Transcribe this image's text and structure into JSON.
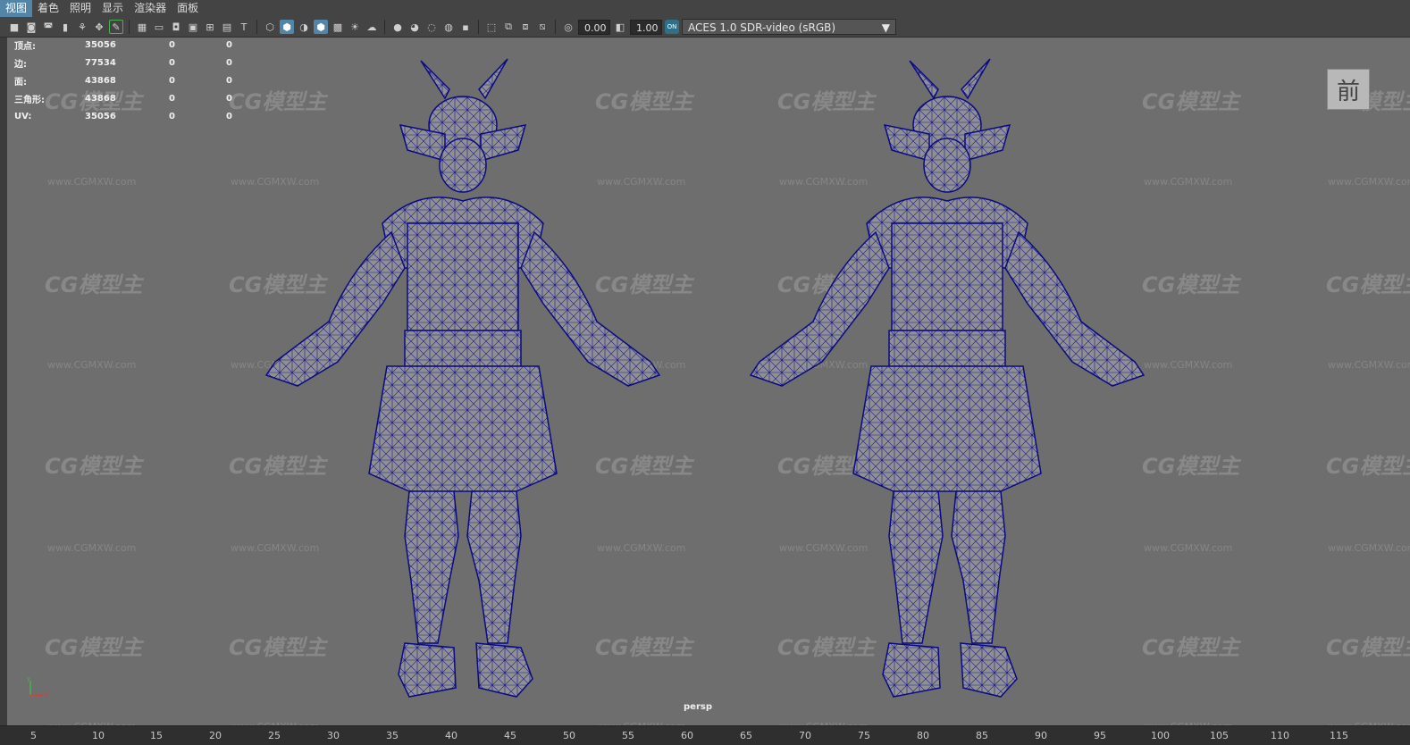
{
  "menu": [
    "视图",
    "着色",
    "照明",
    "显示",
    "渲染器",
    "面板"
  ],
  "toolbar": {
    "exposure": "0.00",
    "gamma": "1.00",
    "colorspace": "ACES 1.0 SDR-video (sRGB)"
  },
  "hud": [
    {
      "label": "顶点:",
      "v1": "35056",
      "v2": "0",
      "v3": "0"
    },
    {
      "label": "边:",
      "v1": "77534",
      "v2": "0",
      "v3": "0"
    },
    {
      "label": "面:",
      "v1": "43868",
      "v2": "0",
      "v3": "0"
    },
    {
      "label": "三角形:",
      "v1": "43868",
      "v2": "0",
      "v3": "0"
    },
    {
      "label": "UV:",
      "v1": "35056",
      "v2": "0",
      "v3": "0"
    }
  ],
  "viewcube_label": "前",
  "camera": "persp",
  "watermark": {
    "logo": "CG模型主",
    "url": "www.CGMXW.com"
  },
  "axis": {
    "y": "y",
    "x": "x"
  },
  "ruler_ticks": [
    "5",
    "10",
    "15",
    "20",
    "25",
    "30",
    "35",
    "40",
    "45",
    "50",
    "55",
    "60",
    "65",
    "70",
    "75",
    "80",
    "85",
    "90",
    "95",
    "100",
    "105",
    "110",
    "115"
  ]
}
